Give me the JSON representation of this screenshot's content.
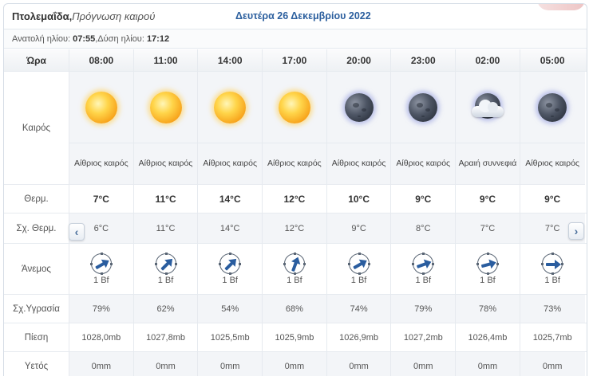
{
  "header": {
    "city": "Πτολεμαΐδα,",
    "subtitle": " Πρόγνωση καιρού",
    "date": "Δευτέρα 26 Δεκεμβρίου 2022"
  },
  "sun_info": {
    "sunrise_label": "Ανατολή ηλίου:",
    "sunrise": "07:55",
    "separator": " , ",
    "sunset_label": "Δύση ηλίου:",
    "sunset": "17:12"
  },
  "labels": {
    "time": "Ώρα",
    "weather": "Καιρός",
    "temp": "Θερμ.",
    "feels": "Σχ. Θερμ.",
    "wind": "Άνεμος",
    "humidity": "Σχ.Υγρασία",
    "pressure": "Πίεση",
    "rain": "Υετός"
  },
  "colors": {
    "accent": "#2c5f9e",
    "wind_arrow": "#2a5d9f"
  },
  "columns": [
    {
      "time": "08:00",
      "icon": "sun-icon",
      "desc": "Αίθριος καιρός",
      "temp": "7°C",
      "feels": "6°C",
      "wind_dir_deg": 60,
      "wind": "1 Bf",
      "humidity": "79%",
      "pressure": "1028,0mb",
      "rain": "0mm"
    },
    {
      "time": "11:00",
      "icon": "sun-icon",
      "desc": "Αίθριος καιρός",
      "temp": "11°C",
      "feels": "11°C",
      "wind_dir_deg": 45,
      "wind": "1 Bf",
      "humidity": "62%",
      "pressure": "1027,8mb",
      "rain": "0mm"
    },
    {
      "time": "14:00",
      "icon": "sun-icon",
      "desc": "Αίθριος καιρός",
      "temp": "14°C",
      "feels": "14°C",
      "wind_dir_deg": 45,
      "wind": "1 Bf",
      "humidity": "54%",
      "pressure": "1025,5mb",
      "rain": "0mm"
    },
    {
      "time": "17:00",
      "icon": "sun-icon",
      "desc": "Αίθριος καιρός",
      "temp": "12°C",
      "feels": "12°C",
      "wind_dir_deg": 20,
      "wind": "1 Bf",
      "humidity": "68%",
      "pressure": "1025,9mb",
      "rain": "0mm"
    },
    {
      "time": "20:00",
      "icon": "moon-icon",
      "desc": "Αίθριος καιρός",
      "temp": "10°C",
      "feels": "9°C",
      "wind_dir_deg": 60,
      "wind": "1 Bf",
      "humidity": "74%",
      "pressure": "1026,9mb",
      "rain": "0mm"
    },
    {
      "time": "23:00",
      "icon": "moon-icon",
      "desc": "Αίθριος καιρός",
      "temp": "9°C",
      "feels": "8°C",
      "wind_dir_deg": 70,
      "wind": "1 Bf",
      "humidity": "79%",
      "pressure": "1027,2mb",
      "rain": "0mm"
    },
    {
      "time": "02:00",
      "icon": "moon-cloud-icon",
      "desc": "Αραιή συννεφιά",
      "temp": "9°C",
      "feels": "7°C",
      "wind_dir_deg": 75,
      "wind": "1 Bf",
      "humidity": "78%",
      "pressure": "1026,4mb",
      "rain": "0mm"
    },
    {
      "time": "05:00",
      "icon": "moon-icon",
      "desc": "Αίθριος καιρός",
      "temp": "9°C",
      "feels": "7°C",
      "wind_dir_deg": 90,
      "wind": "1 Bf",
      "humidity": "73%",
      "pressure": "1025,7mb",
      "rain": "0mm"
    }
  ],
  "nav": {
    "prev_glyph": "‹",
    "next_glyph": "›"
  }
}
